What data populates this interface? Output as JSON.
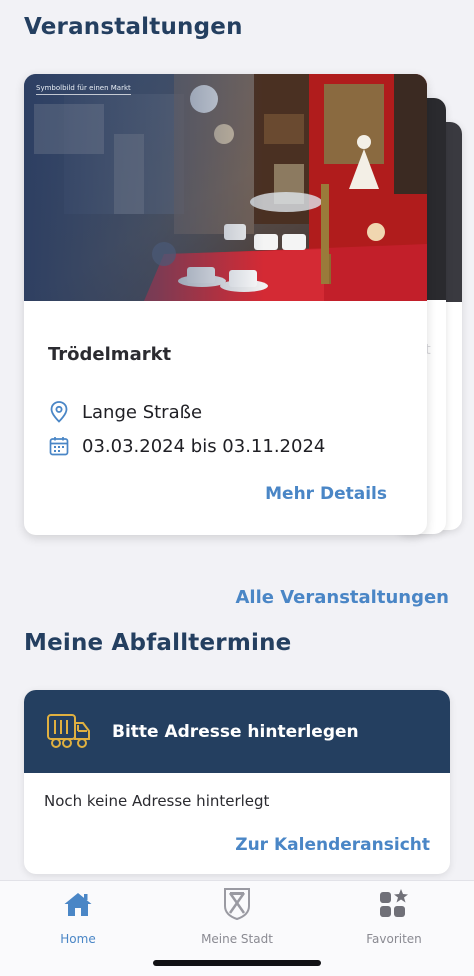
{
  "events": {
    "title": "Veranstaltungen",
    "card": {
      "photo_caption": "Symbolbild für einen Markt",
      "name": "Trödelmarkt",
      "location": "Lange Straße",
      "dates": "03.03.2024 bis 03.11.2024",
      "details_link": "Mehr Details"
    },
    "peek_card_text": "st",
    "all_link": "Alle Veranstaltungen"
  },
  "waste": {
    "title": "Meine Abfalltermine",
    "header_text": "Bitte Adresse hinterlegen",
    "body_text": "Noch keine Adresse hinterlegt",
    "calendar_link": "Zur Kalenderansicht"
  },
  "nav": {
    "items": [
      {
        "label": "Home",
        "icon": "home-icon",
        "active": true
      },
      {
        "label": "Meine Stadt",
        "icon": "city-crest-icon",
        "active": false
      },
      {
        "label": "Favoriten",
        "icon": "favorites-grid-icon",
        "active": false
      }
    ]
  },
  "colors": {
    "primary": "#243f60",
    "accent": "#4a86c6",
    "background": "#f2f2f6",
    "waste_icon": "#e0b040"
  }
}
